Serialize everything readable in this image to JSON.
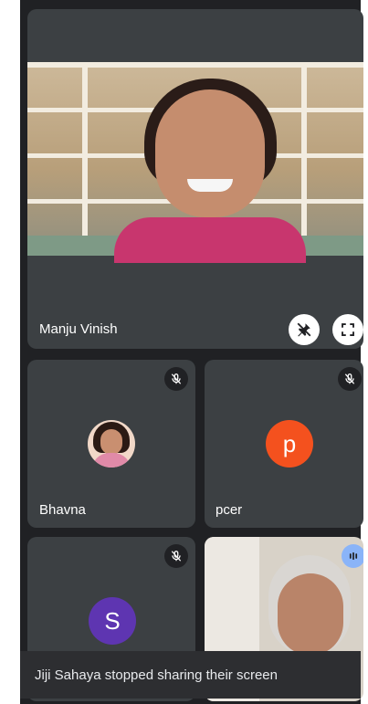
{
  "main_tile": {
    "name": "Manju Vinish"
  },
  "tiles": [
    {
      "name": "Bhavna"
    },
    {
      "name": "pcer",
      "initial": "p",
      "avatar_color": "#f4511e"
    },
    {
      "name": "",
      "initial": "S",
      "avatar_color": "#5e35b1"
    }
  ],
  "toast": {
    "text": "Jiji Sahaya stopped sharing their screen"
  },
  "colors": {
    "tile_bg": "#3c4043",
    "screen_bg": "#202124",
    "accent_speaking": "#8ab4f8"
  },
  "icons": {
    "mic_off": "mic-off-icon",
    "pin_off": "pin-off-icon",
    "fullscreen": "fullscreen-icon",
    "speaking": "audio-level-icon"
  }
}
